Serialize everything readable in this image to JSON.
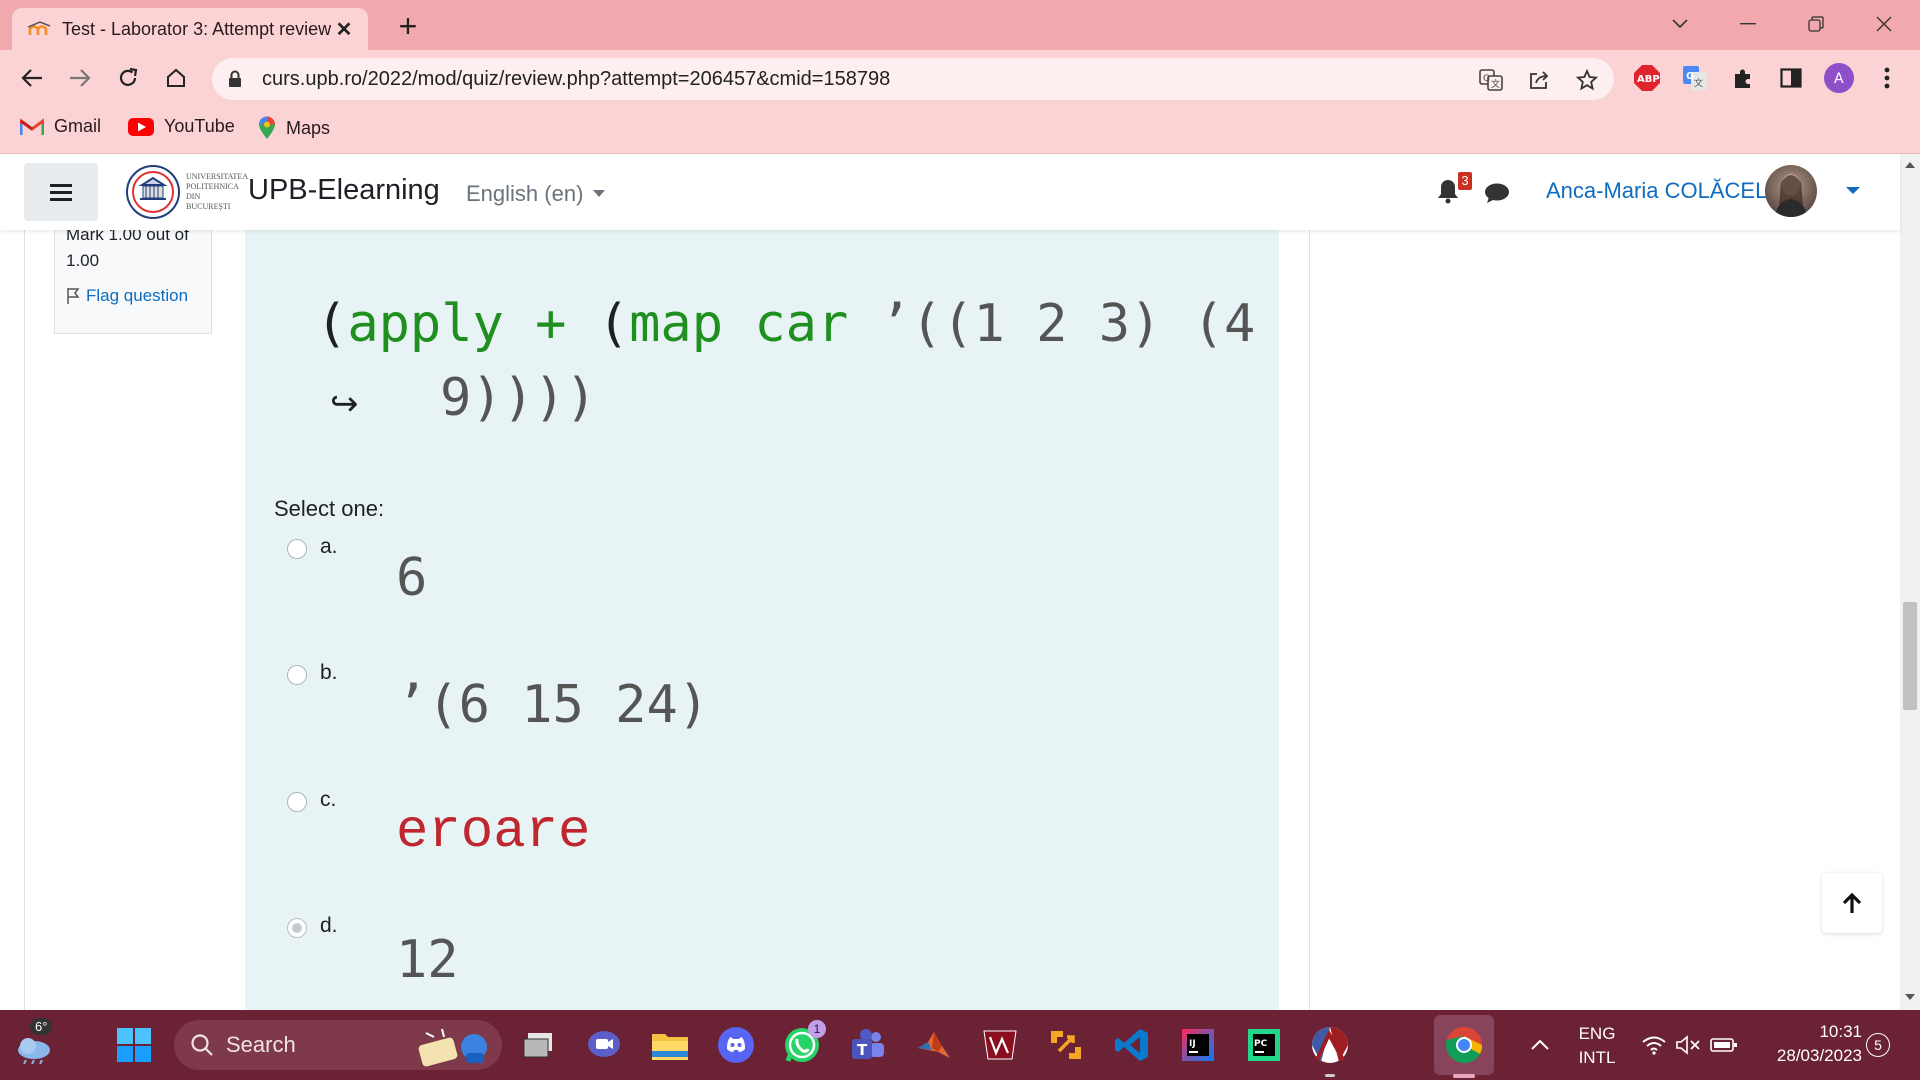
{
  "browser": {
    "tab_title": "Test - Laborator 3: Attempt review",
    "url": "curs.upb.ro/2022/mod/quiz/review.php?attempt=206457&cmid=158798",
    "bookmarks": [
      {
        "label": "Gmail"
      },
      {
        "label": "YouTube"
      },
      {
        "label": "Maps"
      }
    ],
    "profile_initial": "A",
    "abp_label": "ABP"
  },
  "navbar": {
    "logo_text": "UNIVERSITATEA POLITEHNICA DIN BUCUREȘTI",
    "site_name": "UPB-Elearning",
    "language": "English (en)",
    "notification_count": "3",
    "user_name": "Anca-Maria COLĂCEL"
  },
  "question_info": {
    "mark_text": "Mark 1.00 out of 1.00",
    "flag_label": "Flag question"
  },
  "question": {
    "code_line1_parts": [
      "(",
      "apply",
      " ",
      "+",
      " (",
      "map",
      " ",
      "car",
      " ’((1 2 3) (4"
    ],
    "code_line2": "9))))",
    "continuation_symbol": "↪",
    "select_prompt": "Select one:",
    "options": [
      {
        "letter": "a.",
        "value": "6",
        "checked": false
      },
      {
        "letter": "b.",
        "value": "’(6 15 24)",
        "checked": false
      },
      {
        "letter": "c.",
        "value": "eroare",
        "checked": false
      },
      {
        "letter": "d.",
        "value": "12",
        "checked": true
      }
    ]
  },
  "taskbar": {
    "weather_temp": "6°",
    "search_label": "Search",
    "whatsapp_badge": "1",
    "lang_line1": "ENG",
    "lang_line2": "INTL",
    "time": "10:31",
    "date": "28/03/2023",
    "notifications": "5"
  },
  "colors": {
    "accent": "#0f6cbf",
    "keyword_green": "#1f8f1f",
    "error_red": "#c0262d",
    "question_bg": "#e7f3f5",
    "browser_frame": "#f2a9ad",
    "taskbar_bg": "#6b2234"
  }
}
